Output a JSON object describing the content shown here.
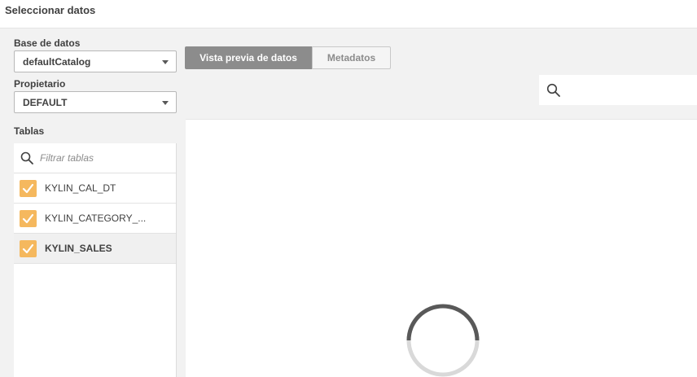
{
  "header": {
    "title": "Seleccionar datos"
  },
  "database": {
    "label": "Base de datos",
    "value": "defaultCatalog",
    "caret_icon": "chevron-down-icon"
  },
  "owner": {
    "label": "Propietario",
    "value": "DEFAULT",
    "caret_icon": "chevron-down-icon"
  },
  "tables": {
    "label": "Tablas",
    "filter_placeholder": "Filtrar tablas",
    "filter_icon": "search-icon",
    "items": [
      {
        "label": "KYLIN_CAL_DT",
        "checked": true,
        "selected": false
      },
      {
        "label": "KYLIN_CATEGORY_...",
        "checked": true,
        "selected": false
      },
      {
        "label": "KYLIN_SALES",
        "checked": true,
        "selected": true
      }
    ]
  },
  "tabs": [
    {
      "label": "Vista previa de datos",
      "active": true
    },
    {
      "label": "Metadatos",
      "active": false
    }
  ],
  "preview_search": {
    "icon": "search-icon",
    "value": ""
  },
  "preview": {
    "state": "loading",
    "loading_icon": "spinner-icon"
  },
  "colors": {
    "checkbox": "#f5b85e",
    "active_tab": "#8c8c8c",
    "background": "#f2f2f2"
  }
}
